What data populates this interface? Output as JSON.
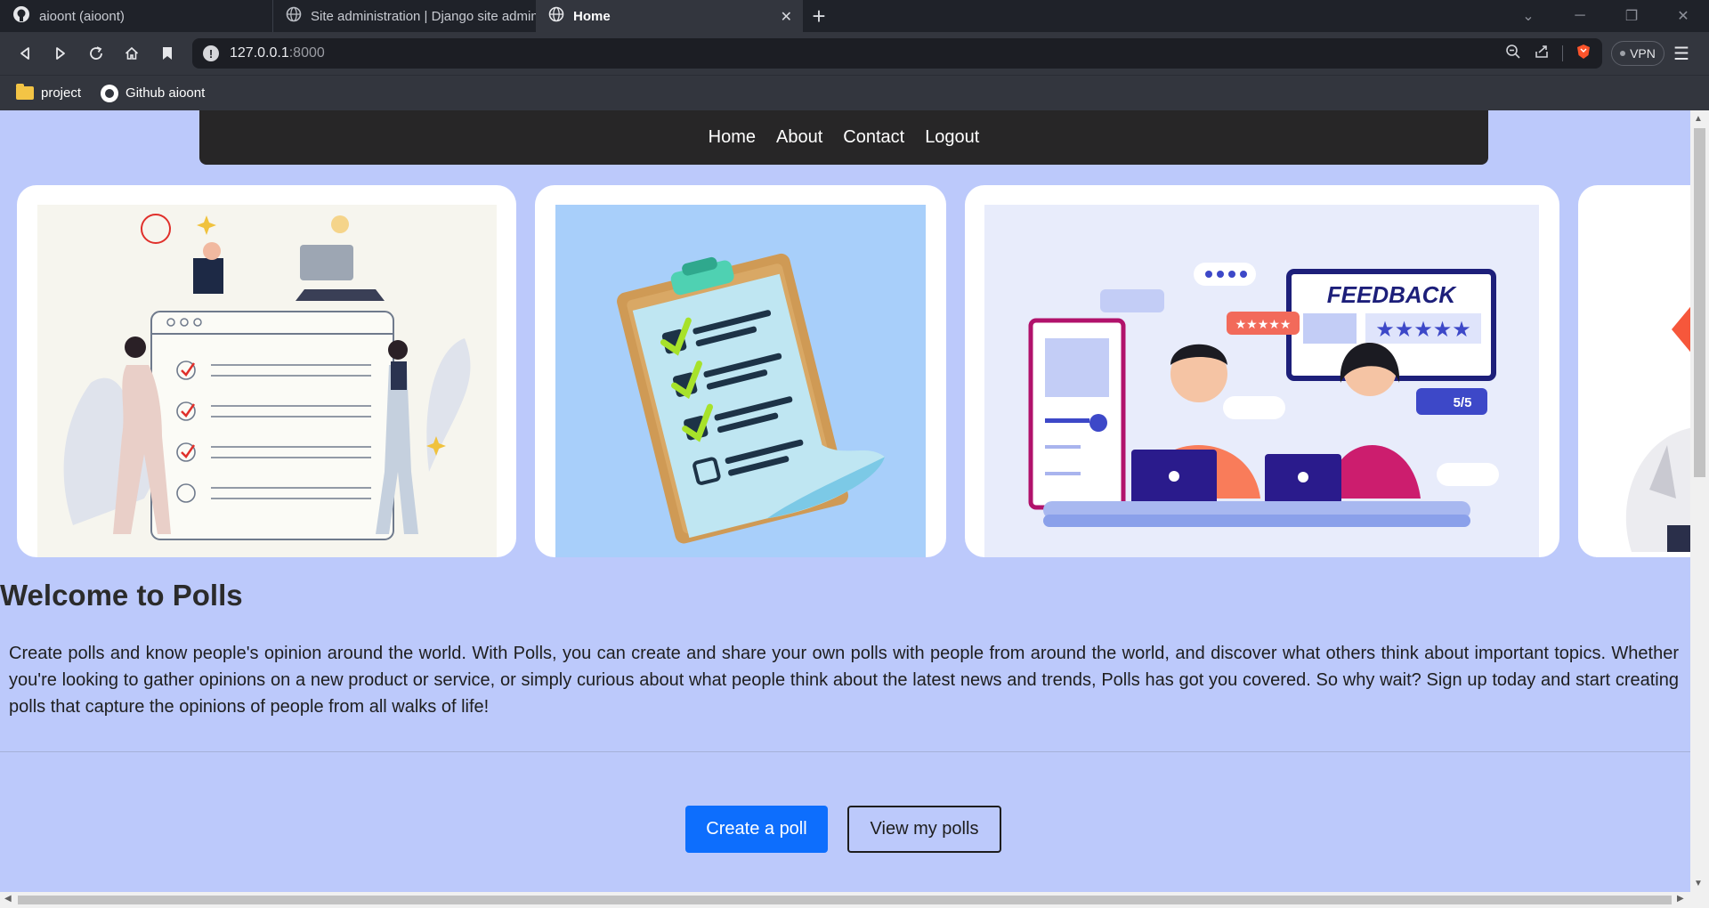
{
  "browser": {
    "tabs": [
      {
        "title": "aioont (aioont)",
        "icon": "github-icon"
      },
      {
        "title": "Site administration | Django site admin",
        "icon": "globe-icon"
      },
      {
        "title": "Home",
        "icon": "globe-icon",
        "active": true
      }
    ],
    "new_tab": "+",
    "url": {
      "host": "127.0.0.1",
      "port": ":8000"
    },
    "vpn_label": "VPN",
    "bookmarks": [
      {
        "label": "project",
        "icon": "folder-icon"
      },
      {
        "label": "Github aioont",
        "icon": "github-icon"
      }
    ]
  },
  "site": {
    "nav": [
      "Home",
      "About",
      "Contact",
      "Logout"
    ],
    "carousel": [
      {
        "icon": "survey-checklist-illustration"
      },
      {
        "icon": "clipboard-checklist-illustration"
      },
      {
        "icon": "feedback-illustration"
      },
      {
        "icon": "partial-illustration"
      }
    ],
    "heading": "Welcome to Polls",
    "intro": "Create polls and know people's opinion around the world. With Polls, you can create and share your own polls with people from around the world, and discover what others think about important topics. Whether you're looking to gather opinions on a new product or service, or simply curious about what people think about the latest news and trends, Polls has got you covered. So why wait? Sign up today and start creating polls that capture the opinions of people from all walks of life!",
    "buttons": {
      "create": "Create a poll",
      "view": "View my polls"
    }
  },
  "illustration_text": {
    "feedback_title": "FEEDBACK",
    "rating": "5/5"
  },
  "colors": {
    "page_bg": "#bcc9fb",
    "nav_bg": "#272627",
    "primary": "#0d6efd"
  }
}
